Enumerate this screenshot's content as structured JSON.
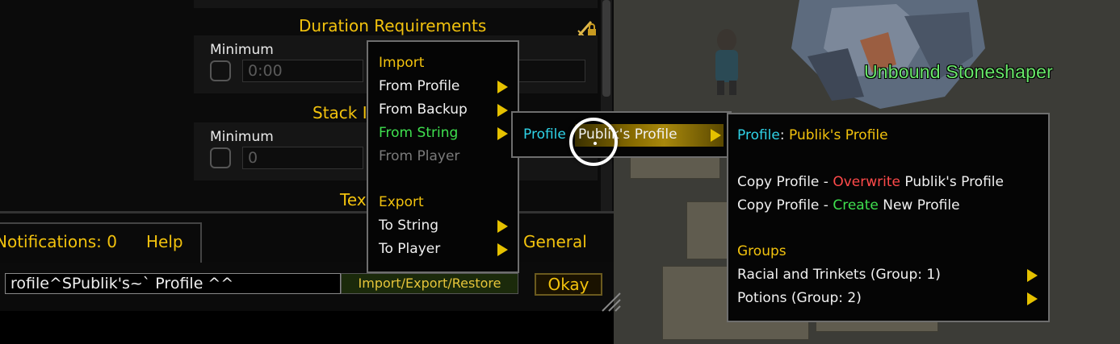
{
  "world": {
    "npc_name": "Unbound Stoneshaper"
  },
  "panel": {
    "duration_title": "Duration Requirements",
    "duration_min_label": "Minimum",
    "duration_min_value": "0:00",
    "stack_title": "Stack I",
    "stack_min_label": "Minimum",
    "stack_min_value": "0",
    "text_title": "Tex",
    "tabs": {
      "notifications": "Notifications: 0",
      "help": "Help",
      "general": "General"
    },
    "string_input_value": "rofile^SPublik's~` Profile ^^",
    "import_export_label": "Import/Export/Restore",
    "okay_label": "Okay"
  },
  "menu1": {
    "import_header": "Import",
    "from_profile": "From Profile",
    "from_backup": "From Backup",
    "from_string": "From String",
    "from_player": "From Player",
    "export_header": "Export",
    "to_string": "To String",
    "to_player": "To Player"
  },
  "menu2": {
    "item_prefix": "Profile",
    "item_name": "Publik's Profile"
  },
  "menu3": {
    "title_prefix": "Profile",
    "title_sep": ":",
    "title_name": "Publik's Profile",
    "copy_overwrite": {
      "pre": "Copy Profile - ",
      "action": "Overwrite",
      "post": "Publik's Profile"
    },
    "copy_create": {
      "pre": "Copy Profile - ",
      "action": "Create",
      "post": "New Profile"
    },
    "groups_header": "Groups",
    "group1": "Racial and Trinkets (Group: 1)",
    "group2": "Potions (Group: 2)"
  },
  "colors": {
    "gold": "#f2c20d",
    "green": "#3fe04f",
    "cyan": "#2fd3e8",
    "red": "#ff4a4a",
    "npc_green": "#69e86a"
  },
  "icons": [
    "lock-icon",
    "submenu-arrow-icon",
    "resize-grip-icon",
    "cursor-ring-icon"
  ]
}
